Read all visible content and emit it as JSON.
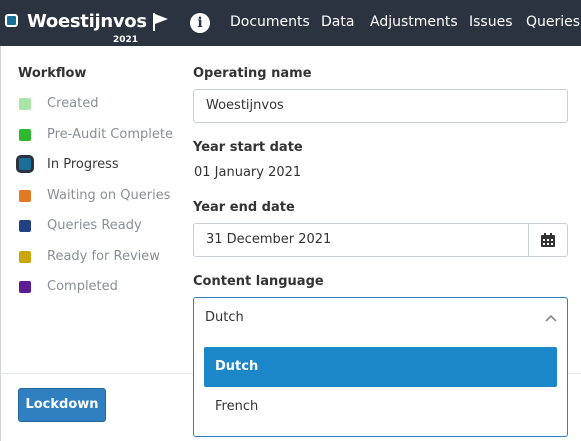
{
  "header": {
    "company_name": "Woestijnvos",
    "company_year": "2021",
    "status_color": "#1a6f98",
    "icons": [
      "flag-icon",
      "info-icon"
    ],
    "info_glyph": "i",
    "nav": [
      "Documents",
      "Data",
      "Adjustments",
      "Issues",
      "Queries"
    ]
  },
  "workflow": {
    "heading": "Workflow",
    "items": [
      {
        "label": "Created",
        "color": "#a8e6a8",
        "active": false
      },
      {
        "label": "Pre-Audit Complete",
        "color": "#2eb82e",
        "active": false
      },
      {
        "label": "In Progress",
        "color": "#1a6f98",
        "active": true
      },
      {
        "label": "Waiting on Queries",
        "color": "#e07b24",
        "active": false
      },
      {
        "label": "Queries Ready",
        "color": "#22417e",
        "active": false
      },
      {
        "label": "Ready for Review",
        "color": "#c9a70a",
        "active": false
      },
      {
        "label": "Completed",
        "color": "#5b1d91",
        "active": false
      }
    ]
  },
  "form": {
    "operating_name_label": "Operating name",
    "operating_name_value": "Woestijnvos",
    "year_start_label": "Year start date",
    "year_start_value": "01 January 2021",
    "year_end_label": "Year end date",
    "year_end_value": "31 December 2021",
    "content_language_label": "Content language",
    "content_language_value": "Dutch",
    "language_options": [
      {
        "label": "Dutch",
        "selected": true
      },
      {
        "label": "French",
        "selected": false
      }
    ]
  },
  "actions": {
    "lockdown_label": "Lockdown"
  },
  "colors": {
    "topbar": "#2c3340",
    "accent": "#2f7fc1",
    "selected_option": "#1b87c9"
  }
}
